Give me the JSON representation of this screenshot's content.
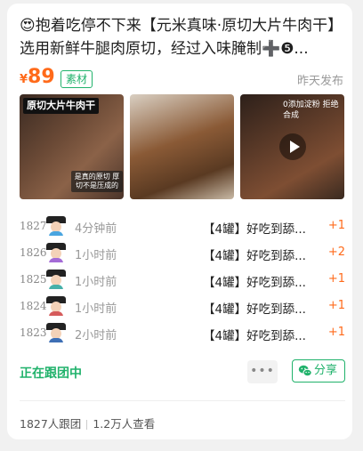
{
  "post": {
    "title": "😍抱着吃停不下来【元米真味·原切大片牛肉干】选用新鲜牛腿肉原切，经过入味腌制➕❺...",
    "price_currency": "¥",
    "price_value": "89",
    "tag": "素材",
    "posted": "昨天发布"
  },
  "thumbs": {
    "t1_banner": "原切大片牛肉干",
    "t1_note": "是真的原切 厚切不是压成的",
    "t3_caption": "0添加淀粉 拒绝合成"
  },
  "orders": [
    {
      "num": "1827",
      "time": "4分钟前",
      "item": "【4罐】好吃到舔...",
      "qty": "+1",
      "avatar_color": "#4aa5e0"
    },
    {
      "num": "1826",
      "time": "1小时前",
      "item": "【4罐】好吃到舔...",
      "qty": "+2",
      "avatar_color": "#a46bd6"
    },
    {
      "num": "1825",
      "time": "1小时前",
      "item": "【4罐】好吃到舔...",
      "qty": "+1",
      "avatar_color": "#46b0a9"
    },
    {
      "num": "1824",
      "time": "1小时前",
      "item": "【4罐】好吃到舔...",
      "qty": "+1",
      "avatar_color": "#d55b5b"
    },
    {
      "num": "1823",
      "time": "2小时前",
      "item": "【4罐】好吃到舔...",
      "qty": "+1",
      "avatar_color": "#3e6fb5"
    }
  ],
  "actions": {
    "following": "正在跟团中",
    "more": "•••",
    "share": "分享"
  },
  "stats": {
    "followers": "1827人跟团",
    "views": "1.2万人查看"
  },
  "colors": {
    "accent_green": "#20b26b",
    "price_orange": "#ff6a1a"
  }
}
